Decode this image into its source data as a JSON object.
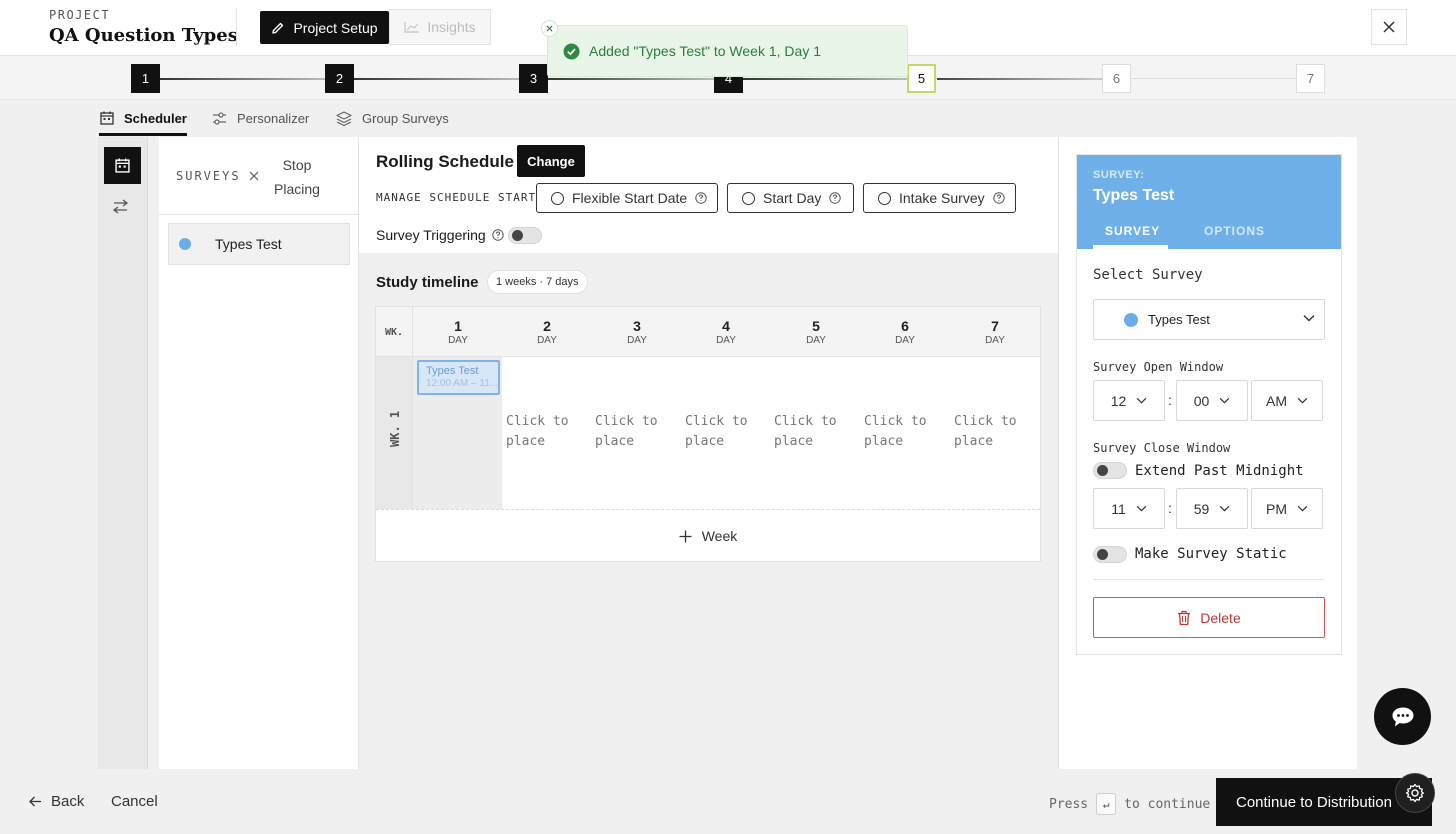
{
  "header": {
    "project_label": "PROJECT",
    "project_title": "QA Question Types",
    "tabs": [
      {
        "label": "Project Setup",
        "icon": "pencil-icon",
        "active": true
      },
      {
        "label": "Insights",
        "icon": "chart-line-icon",
        "active": false
      }
    ],
    "close_icon": "close-icon"
  },
  "stepper": {
    "steps": [
      "1",
      "2",
      "3",
      "4",
      "5",
      "6",
      "7"
    ],
    "current": "5"
  },
  "toast": {
    "message": "Added \"Types Test\" to Week 1, Day 1",
    "icon": "check-circle-icon",
    "color": "#2a7d3a"
  },
  "main_tabs": [
    {
      "label": "Scheduler",
      "icon": "calendar-icon",
      "active": true
    },
    {
      "label": "Personalizer",
      "icon": "sliders-icon",
      "active": false
    },
    {
      "label": "Group Surveys",
      "icon": "layers-icon",
      "active": false
    }
  ],
  "surveys_panel": {
    "label": "SURVEYS",
    "stop_placing": "Stop Placing",
    "items": [
      {
        "name": "Types Test",
        "color": "#6aaee8"
      }
    ]
  },
  "schedule": {
    "title": "Rolling Schedule",
    "change_label": "Change",
    "manage_start_label": "MANAGE SCHEDULE START",
    "start_options": [
      "Flexible Start Date",
      "Start Day",
      "Intake Survey"
    ],
    "triggering_label": "Survey Triggering",
    "triggering_on": false
  },
  "timeline": {
    "title": "Study timeline",
    "badge": "1 weeks · 7 days",
    "week_header": "WK.",
    "day_label": "DAY",
    "days": [
      "1",
      "2",
      "3",
      "4",
      "5",
      "6",
      "7"
    ],
    "week_label": "WK. 1",
    "placed": {
      "name": "Types Test",
      "time": "12:00 AM – 11..."
    },
    "placeholder": "Click to place",
    "add_week": "Week"
  },
  "survey_settings": {
    "label": "SURVEY:",
    "title": "Types Test",
    "tabs": [
      "SURVEY",
      "OPTIONS"
    ],
    "accent": "#6fb0e8",
    "select_label": "Select Survey",
    "selected_survey": "Types Test",
    "open_window_label": "Survey Open Window",
    "open": {
      "hour": "12",
      "minute": "00",
      "ampm": "AM"
    },
    "close_window_label": "Survey Close Window",
    "extend_label": "Extend Past Midnight",
    "extend_on": false,
    "close": {
      "hour": "11",
      "minute": "59",
      "ampm": "PM"
    },
    "static_label": "Make Survey Static",
    "static_on": false,
    "delete_label": "Delete",
    "delete_color": "#d9534f"
  },
  "footer": {
    "back": "Back",
    "cancel": "Cancel",
    "press": "Press",
    "key": "↵",
    "to_continue": "to continue",
    "continue_label": "Continue to Distribution"
  }
}
